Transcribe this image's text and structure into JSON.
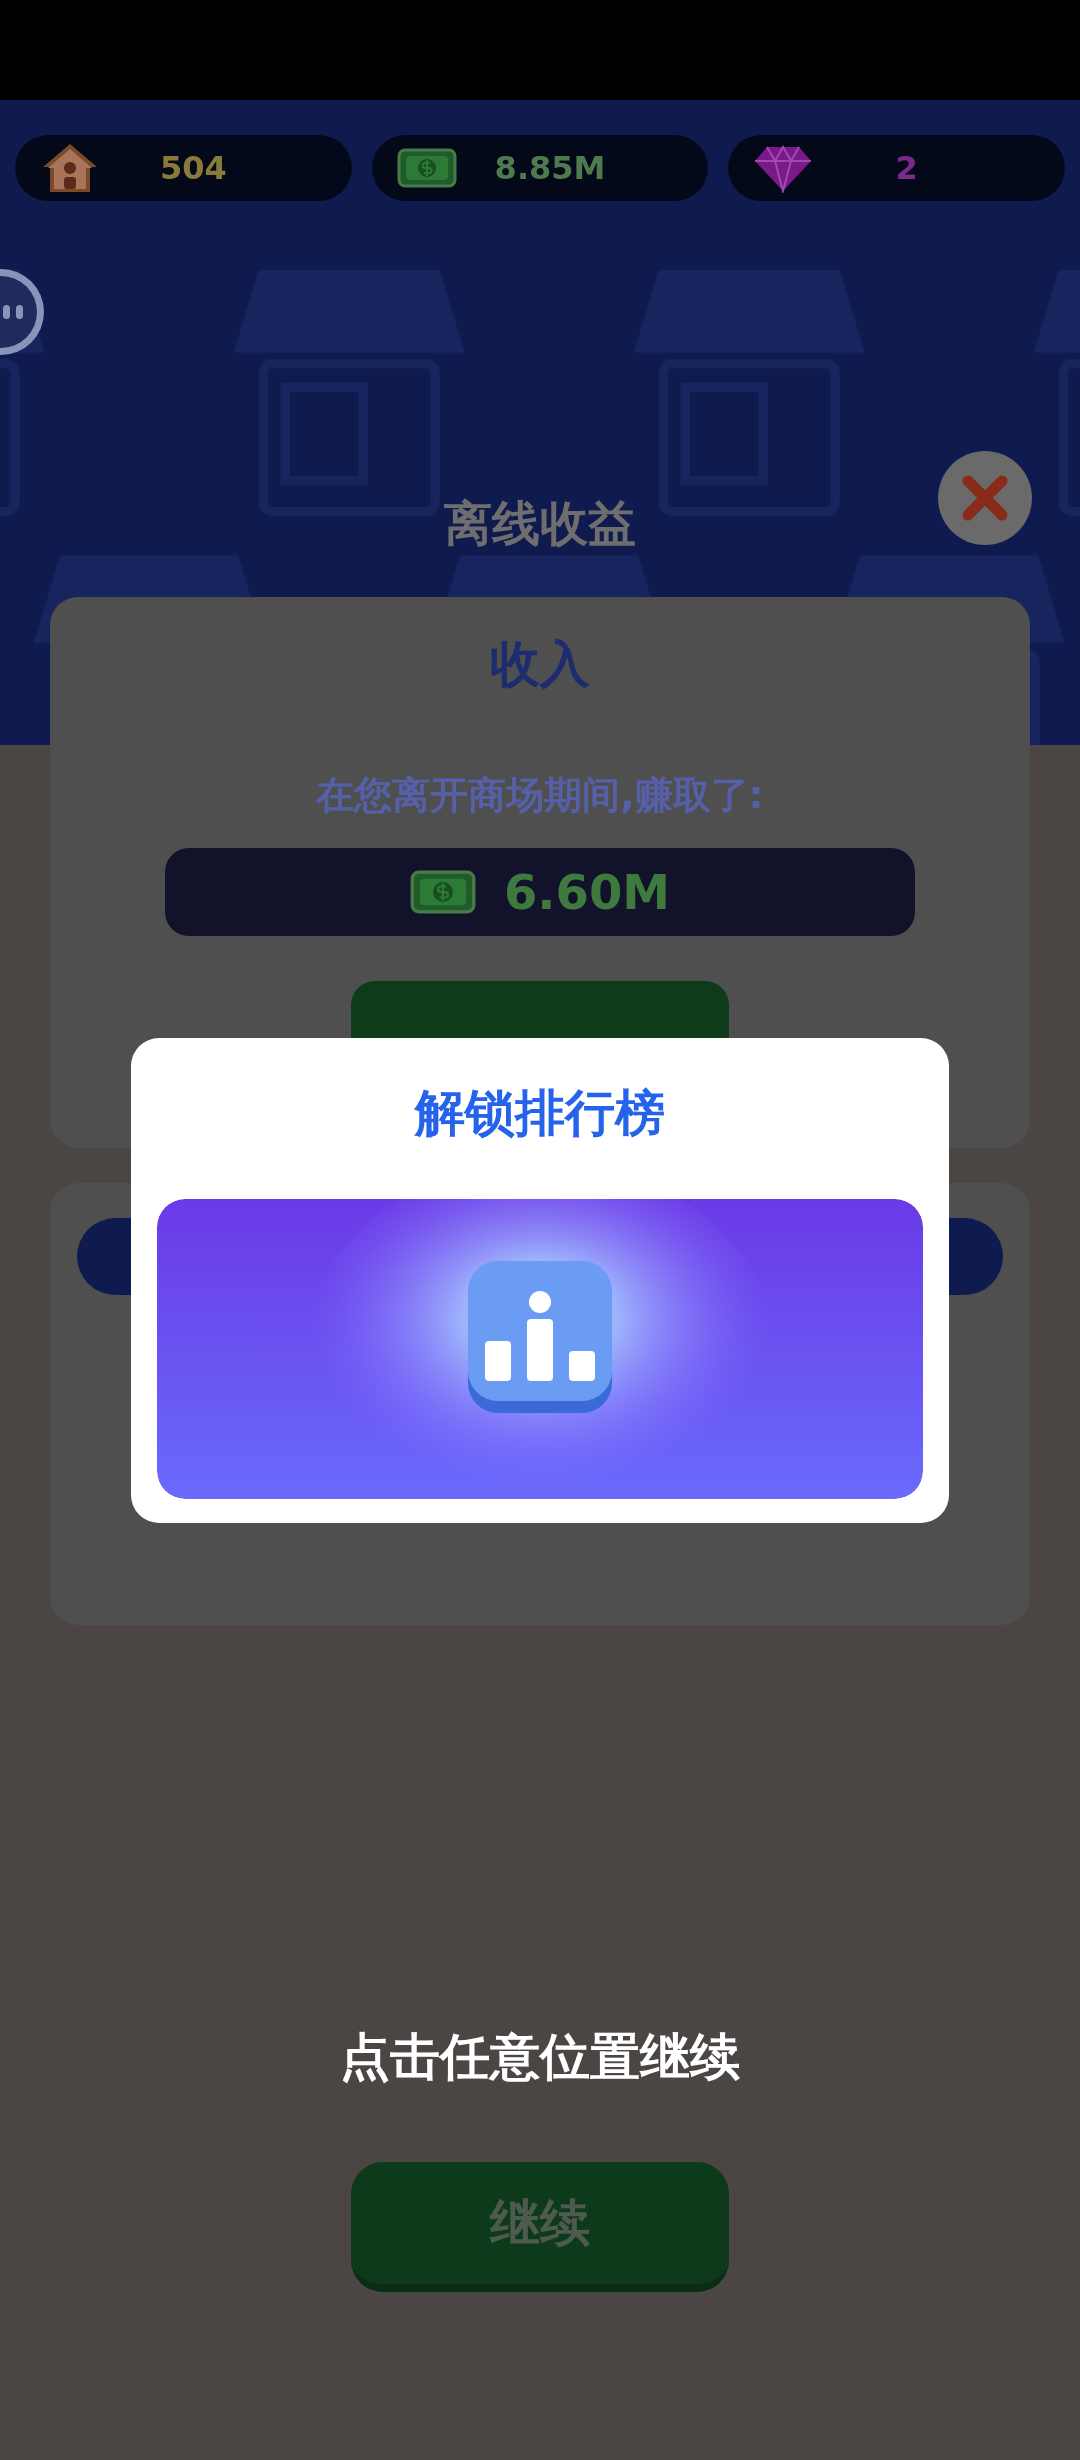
{
  "resources": [
    {
      "kind": "house",
      "value": "504"
    },
    {
      "kind": "cash",
      "value": "8.85M"
    },
    {
      "kind": "gem",
      "value": "2"
    }
  ],
  "dialog": {
    "title": "离线收益",
    "card": {
      "heading": "收入",
      "message": "在您离开商场期间,赚取了:",
      "amount": "6.60M"
    }
  },
  "popup": {
    "title": "解锁排行榜"
  },
  "hint": "点击任意位置继续",
  "continue_button": "继续"
}
